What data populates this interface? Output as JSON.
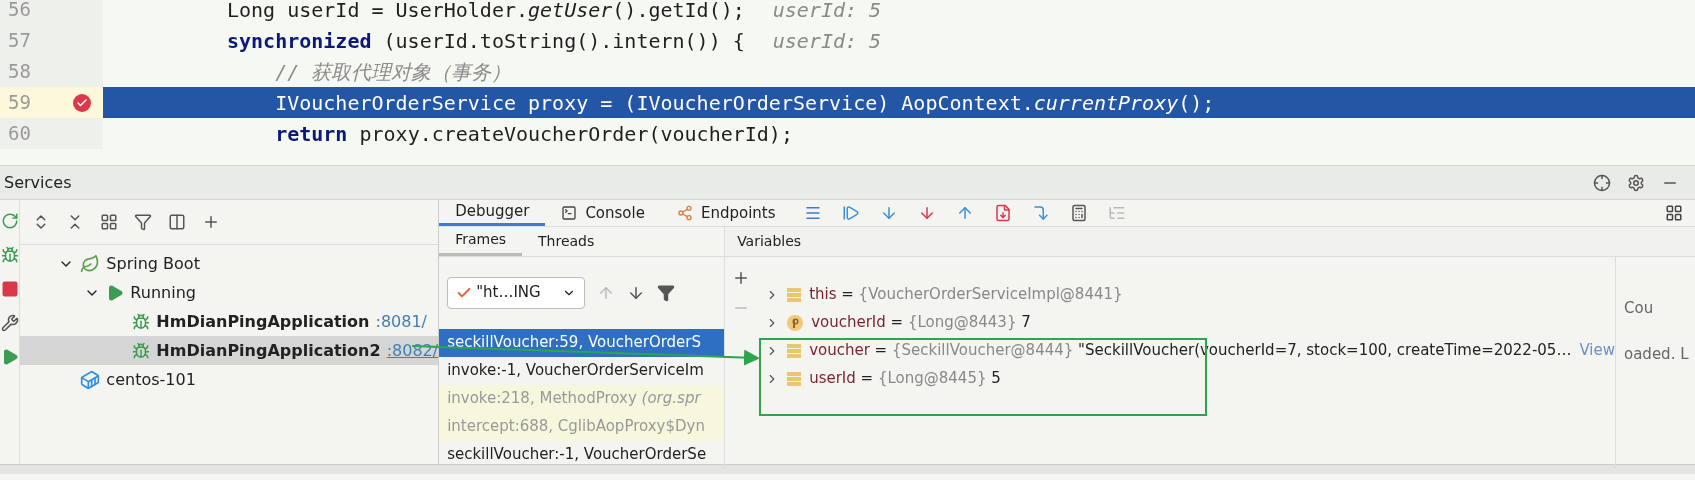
{
  "editor": {
    "lines": [
      {
        "number": "56",
        "breakpoint": false,
        "current": false,
        "segments": [
          {
            "kind": "plain",
            "text": "Long userId = UserHolder."
          },
          {
            "kind": "italic",
            "text": "getUser"
          },
          {
            "kind": "plain",
            "text": "().getId();"
          }
        ],
        "hint": "userId: 5"
      },
      {
        "number": "57",
        "breakpoint": false,
        "current": false,
        "segments": [
          {
            "kind": "keyword",
            "text": "synchronized"
          },
          {
            "kind": "plain",
            "text": " (userId.toString().intern()) {"
          }
        ],
        "hint": "userId: 5"
      },
      {
        "number": "58",
        "breakpoint": false,
        "current": false,
        "segments": [
          {
            "kind": "comment",
            "text": "    // 获取代理对象（事务）"
          }
        ]
      },
      {
        "number": "59",
        "breakpoint": true,
        "current": true,
        "segments": [
          {
            "kind": "plain",
            "text": "    IVoucherOrderService proxy = (IVoucherOrderService) AopContext."
          },
          {
            "kind": "italic",
            "text": "currentProxy"
          },
          {
            "kind": "plain",
            "text": "();"
          }
        ]
      },
      {
        "number": "60",
        "breakpoint": false,
        "current": false,
        "segments": [
          {
            "kind": "keyword",
            "text": "    return"
          },
          {
            "kind": "plain",
            "text": " proxy.createVoucherOrder(voucherId);"
          }
        ]
      }
    ]
  },
  "services": {
    "title": "Services",
    "tree": [
      {
        "label": "Spring Boot",
        "kind": "spring",
        "expanded": true,
        "selected": false,
        "children": [
          {
            "label": "Running",
            "kind": "running",
            "expanded": true,
            "selected": false,
            "children": [
              {
                "label": "HmDianPingApplication",
                "port": ":8081/",
                "kind": "app",
                "selected": false
              },
              {
                "label": "HmDianPingApplication2",
                "port": ":8082/",
                "kind": "app",
                "selected": true
              }
            ]
          }
        ]
      },
      {
        "label": "centos-101",
        "kind": "docker",
        "selected": false
      }
    ]
  },
  "debugger": {
    "tabs": [
      {
        "label": "Debugger",
        "selected": true
      },
      {
        "label": "Console",
        "selected": false
      },
      {
        "label": "Endpoints",
        "selected": false
      }
    ],
    "frame_tabs": [
      {
        "label": "Frames",
        "selected": true
      },
      {
        "label": "Threads",
        "selected": false
      }
    ],
    "thread": "\"ht…ING",
    "frames": [
      {
        "text": "seckillVoucher:59, VoucherOrderS",
        "selected": true,
        "library": false
      },
      {
        "text": "invoke:-1, VoucherOrderServiceIm",
        "selected": false,
        "library": false
      },
      {
        "text": "invoke:218, MethodProxy",
        "package": "(org.spr",
        "selected": false,
        "library": true
      },
      {
        "text": "intercept:688, CglibAopProxy$Dyn",
        "selected": false,
        "library": true
      },
      {
        "text": "seckillVoucher:-1, VoucherOrderSe",
        "selected": false,
        "library": false
      }
    ],
    "variables_title": "Variables",
    "variables": [
      {
        "kind": "field",
        "name": "this",
        "sign": "=",
        "type": "{VoucherOrderServiceImpl@8441}"
      },
      {
        "kind": "param",
        "name": "voucherId",
        "sign": "=",
        "type": "{Long@8443}",
        "value": "7"
      },
      {
        "kind": "field",
        "name": "voucher",
        "sign": "=",
        "type": "{SeckillVoucher@8444}",
        "value": "\"SeckillVoucher(voucherId=7, stock=100, createTime=2022-05…",
        "link": "View"
      },
      {
        "kind": "field",
        "name": "userId",
        "sign": "=",
        "type": "{Long@8445}",
        "value": "5"
      }
    ],
    "side_texts": [
      "Cou",
      "oaded. L"
    ]
  }
}
